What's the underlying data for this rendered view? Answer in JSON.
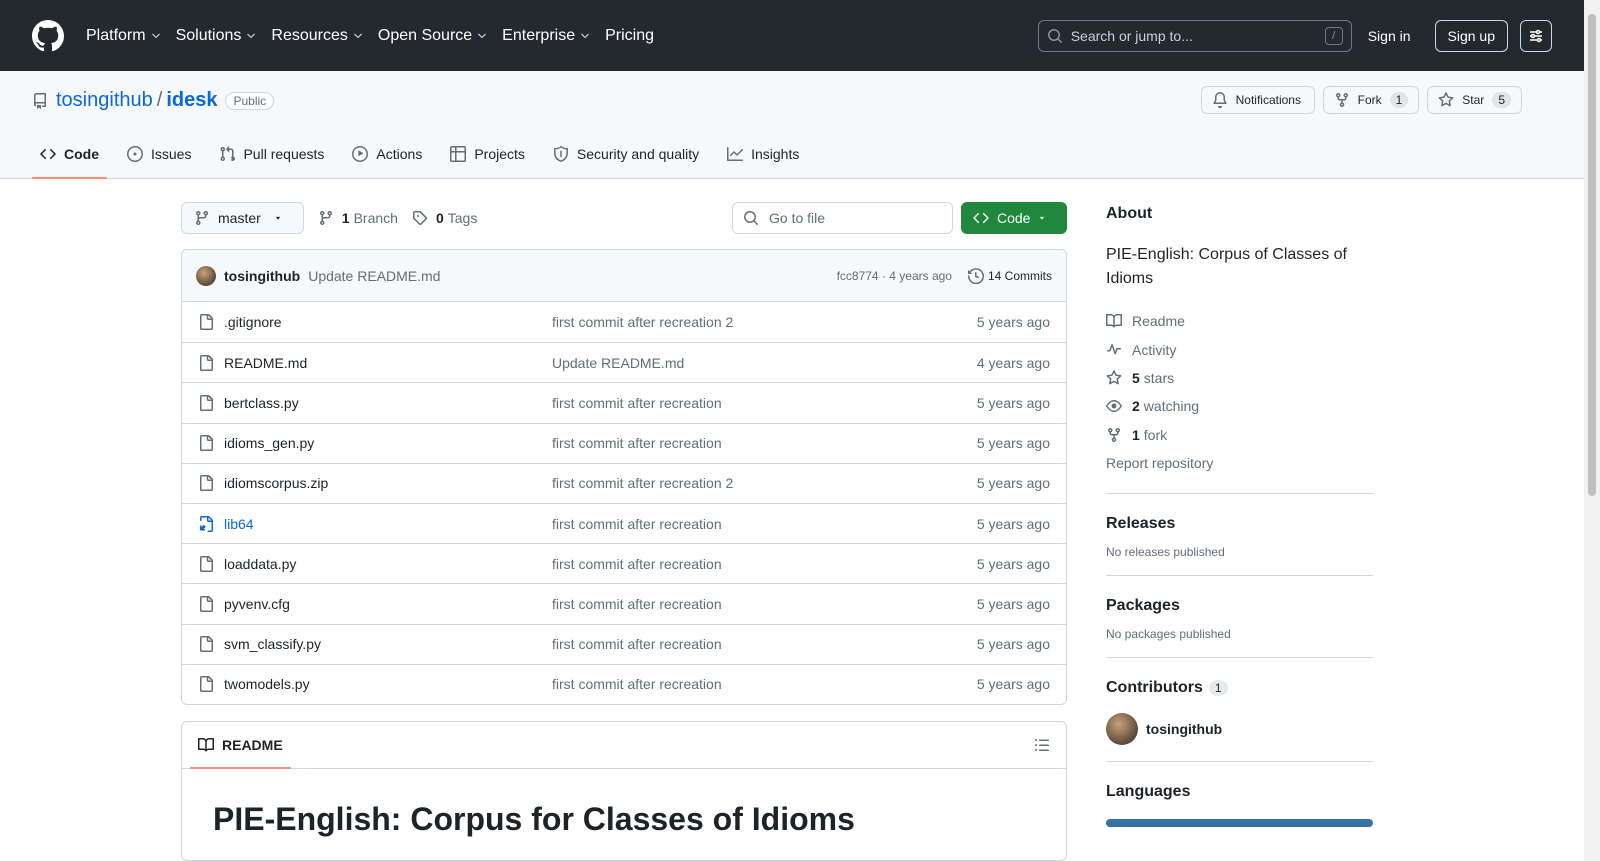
{
  "header": {
    "nav": [
      {
        "label": "Platform",
        "has_menu": true
      },
      {
        "label": "Solutions",
        "has_menu": true
      },
      {
        "label": "Resources",
        "has_menu": true
      },
      {
        "label": "Open Source",
        "has_menu": true
      },
      {
        "label": "Enterprise",
        "has_menu": true
      },
      {
        "label": "Pricing",
        "has_menu": false
      }
    ],
    "search_placeholder": "Search or jump to...",
    "search_shortcut": "/",
    "signin": "Sign in",
    "signup": "Sign up"
  },
  "repo": {
    "owner": "tosingithub",
    "separator": "/",
    "name": "idesk",
    "visibility": "Public",
    "notifications_label": "Notifications",
    "fork_label": "Fork",
    "fork_count": "1",
    "star_label": "Star",
    "star_count": "5",
    "tabs": [
      {
        "label": "Code",
        "icon": "code-icon",
        "active": true
      },
      {
        "label": "Issues",
        "icon": "issue-icon",
        "active": false
      },
      {
        "label": "Pull requests",
        "icon": "pull-request-icon",
        "active": false
      },
      {
        "label": "Actions",
        "icon": "play-icon",
        "active": false
      },
      {
        "label": "Projects",
        "icon": "table-icon",
        "active": false
      },
      {
        "label": "Security and quality",
        "icon": "shield-icon",
        "active": false
      },
      {
        "label": "Insights",
        "icon": "graph-icon",
        "active": false
      }
    ]
  },
  "toolbar": {
    "branch": "master",
    "branches_count": "1",
    "branches_label": "Branch",
    "tags_count": "0",
    "tags_label": "Tags",
    "goto_placeholder": "Go to file",
    "code_button": "Code"
  },
  "latest_commit": {
    "author": "tosingithub",
    "message": "Update README.md",
    "hash_age": "fcc8774 · 4 years ago",
    "commits_label": "14 Commits"
  },
  "files": [
    {
      "name": ".gitignore",
      "type": "file",
      "commit": "first commit after recreation 2",
      "age": "5 years ago"
    },
    {
      "name": "README.md",
      "type": "file",
      "commit": "Update README.md",
      "age": "4 years ago"
    },
    {
      "name": "bertclass.py",
      "type": "file",
      "commit": "first commit after recreation",
      "age": "5 years ago"
    },
    {
      "name": "idioms_gen.py",
      "type": "file",
      "commit": "first commit after recreation",
      "age": "5 years ago"
    },
    {
      "name": "idiomscorpus.zip",
      "type": "file",
      "commit": "first commit after recreation 2",
      "age": "5 years ago"
    },
    {
      "name": "lib64",
      "type": "symlink",
      "commit": "first commit after recreation",
      "age": "5 years ago"
    },
    {
      "name": "loaddata.py",
      "type": "file",
      "commit": "first commit after recreation",
      "age": "5 years ago"
    },
    {
      "name": "pyvenv.cfg",
      "type": "file",
      "commit": "first commit after recreation",
      "age": "5 years ago"
    },
    {
      "name": "svm_classify.py",
      "type": "file",
      "commit": "first commit after recreation",
      "age": "5 years ago"
    },
    {
      "name": "twomodels.py",
      "type": "file",
      "commit": "first commit after recreation",
      "age": "5 years ago"
    }
  ],
  "readme": {
    "tab_label": "README",
    "heading": "PIE-English: Corpus for Classes of Idioms"
  },
  "sidebar": {
    "about_title": "About",
    "description": "PIE-English: Corpus of Classes of Idioms",
    "readme": "Readme",
    "activity": "Activity",
    "stars_count": "5",
    "stars_label": "stars",
    "watching_count": "2",
    "watching_label": "watching",
    "fork_count": "1",
    "fork_label": "fork",
    "report": "Report repository",
    "releases_title": "Releases",
    "releases_text": "No releases published",
    "packages_title": "Packages",
    "packages_text": "No packages published",
    "contributors_title": "Contributors",
    "contributors_count": "1",
    "contributor_name": "tosingithub",
    "languages_title": "Languages"
  },
  "colors": {
    "header_bg": "#24292f",
    "link": "#0969da",
    "primary_button": "#1f883d",
    "active_tab_underline": "#fd8c73",
    "language_python": "#3572a5"
  }
}
